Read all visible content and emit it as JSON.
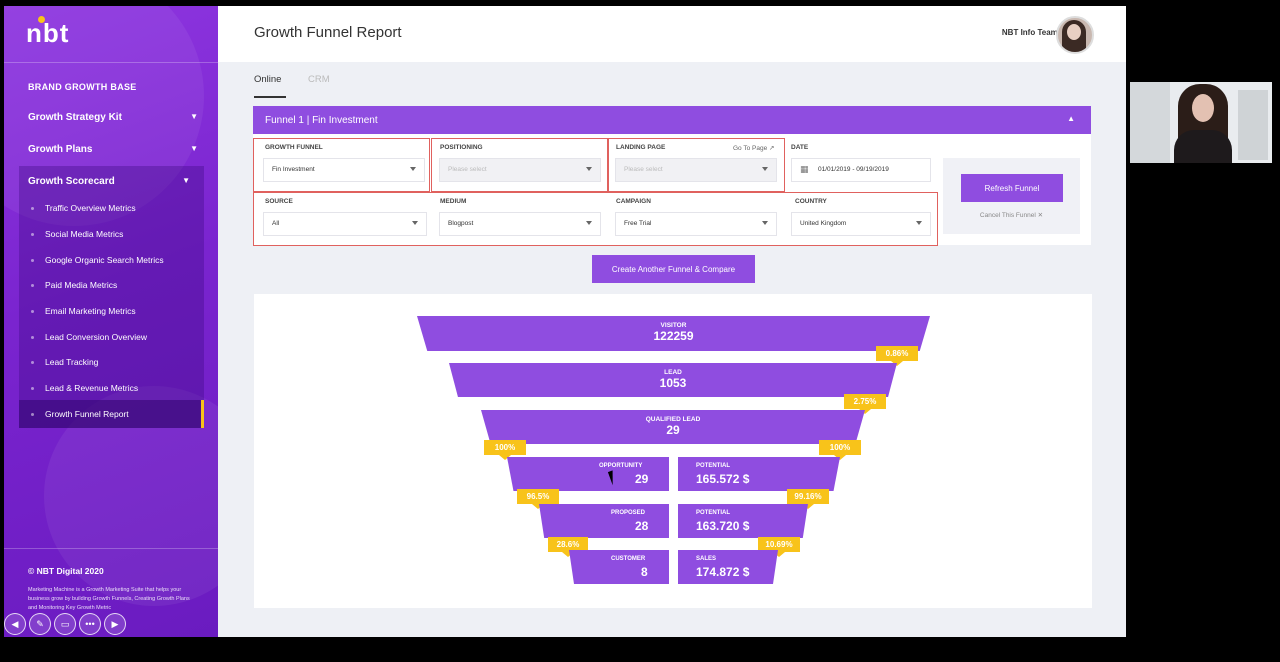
{
  "brand": {
    "logo": "nbt",
    "accent": "#8f4de0",
    "highlight": "#f8c31a"
  },
  "sidebar": {
    "section_title": "BRAND GROWTH BASE",
    "items": [
      {
        "label": "Growth Strategy Kit",
        "icon": "chevron-down-icon"
      },
      {
        "label": "Growth Plans",
        "icon": "chevron-down-icon"
      },
      {
        "label": "Growth Scorecard",
        "icon": "chevron-down-icon"
      }
    ],
    "sub_items": [
      "Traffic Overview Metrics",
      "Social Media Metrics",
      "Google Organic Search Metrics",
      "Paid Media Metrics",
      "Email Marketing Metrics",
      "Lead Conversion Overview",
      "Lead Tracking",
      "Lead & Revenue Metrics",
      "Growth Funnel Report"
    ],
    "active_sub_item": "Growth Funnel Report",
    "copyright": "© NBT Digital 2020",
    "description": "Marketing Machine is a Growth Marketing Suite that helps your business grow by building Growth Funnels, Creating Growth Plans and Monitoring Key Growth Metric"
  },
  "header": {
    "title": "Growth Funnel Report",
    "user_name": "NBT Info Team ▾"
  },
  "tabs": [
    {
      "label": "Online",
      "active": true
    },
    {
      "label": "CRM",
      "active": false
    }
  ],
  "funnel_panel": {
    "title": "Funnel 1 | Fin Investment",
    "collapse_icon": "▲",
    "filters": {
      "growth_funnel": {
        "label": "GROWTH FUNNEL",
        "value": "Fin Investment"
      },
      "positioning": {
        "label": "POSITIONING",
        "placeholder": "Please select"
      },
      "landing_page": {
        "label": "LANDING PAGE",
        "placeholder": "Please select",
        "link": "Go To Page"
      },
      "date": {
        "label": "DATE",
        "value": "01/01/2019 - 09/19/2019"
      },
      "source": {
        "label": "SOURCE",
        "value": "All"
      },
      "medium": {
        "label": "MEDIUM",
        "value": "Blogpost"
      },
      "campaign": {
        "label": "CAMPAIGN",
        "value": "Free Trial"
      },
      "country": {
        "label": "COUNTRY",
        "value": "United Kingdom"
      }
    },
    "refresh_button": "Refresh Funnel",
    "cancel_link": "Cancel This Funnel ✕",
    "create_button": "Create Another Funnel & Compare"
  },
  "funnel": {
    "visitor": {
      "label": "VISITOR",
      "value": "122259"
    },
    "lead": {
      "label": "LEAD",
      "value": "1053"
    },
    "qualified_lead": {
      "label": "QUALIFIED LEAD",
      "value": "29"
    },
    "opportunity": {
      "label": "OPPORTUNITY",
      "value": "29"
    },
    "potential_1": {
      "label": "POTENTIAL",
      "value": "165.572 $"
    },
    "proposed": {
      "label": "PROPOSED",
      "value": "28"
    },
    "potential_2": {
      "label": "POTENTIAL",
      "value": "163.720 $"
    },
    "customer": {
      "label": "CUSTOMER",
      "value": "8"
    },
    "sales": {
      "label": "SALES",
      "value": "174.872 $"
    },
    "rates": {
      "visitor_to_lead": "0.86%",
      "lead_to_qualified": "2.75%",
      "qualified_left": "100%",
      "qualified_right": "100%",
      "opportunity_to_proposed": "96.5%",
      "potential_change": "99.16%",
      "proposed_to_customer": "28.6%",
      "sales_change": "10.69%"
    }
  },
  "toolbar_icons": [
    "arrow-left-icon",
    "pen-icon",
    "screen-icon",
    "more-icon",
    "arrow-right-icon"
  ]
}
